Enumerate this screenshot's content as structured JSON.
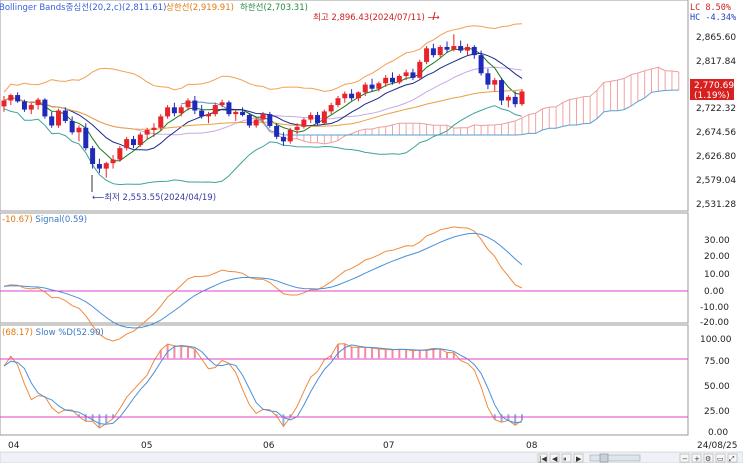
{
  "header": {
    "bb_label": "Bollinger Bands중심선(20,2,c)(2,811.61)",
    "upper_label": "상한선(2,919.91)",
    "lower_label": "하한선(2,703.31)"
  },
  "corner_stats": [
    {
      "key": "LC",
      "value": "8.50%"
    },
    {
      "key": "HC",
      "value": "-4.34%"
    }
  ],
  "annotations": {
    "high": "최고 2,896.43(2024/07/11)",
    "low": "최저 2,553.55(2024/04/19)"
  },
  "price_panel": {
    "yticks": [
      "2,865.60",
      "2,817.84",
      "2,722.32",
      "2,674.56",
      "2,626.80",
      "2,579.04",
      "2,531.28"
    ],
    "ylim": [
      2511,
      2945
    ],
    "current_price": "2,770.69",
    "current_change": "(1.19%)"
  },
  "macd_panel": {
    "macd_label": "-10.67)",
    "signal_label": "Signal(0.59)",
    "yticks": [
      "30.00",
      "20.00",
      "10.00",
      "0.00",
      "-10.00",
      "-20.00"
    ]
  },
  "stoch_panel": {
    "k_label": "(68.17)",
    "d_label": "Slow %D(52.90)",
    "yticks": [
      "100.00",
      "75.00",
      "50.00",
      "25.00",
      "0.00"
    ]
  },
  "x_axis": {
    "ticks": [
      "04",
      "05",
      "06",
      "07",
      "08"
    ],
    "date": "24/08/25"
  },
  "colors": {
    "up": "#e8232a",
    "down": "#1f2ab8",
    "ichimoku_fill": "#f2a1a1",
    "bb_band": "#f0a050",
    "bb_mid": "#c8a8e8",
    "macd": "#f08a3c",
    "signal": "#4a90d9",
    "guide": "#e040c8"
  },
  "chart_data": {
    "type": "candlestick",
    "title": "",
    "indicators": [
      "Bollinger Bands(20,2,c)",
      "Ichimoku cloud",
      "Moving averages",
      "MACD",
      "Signal",
      "Slow %K",
      "Slow %D"
    ],
    "price_ylim": [
      2511,
      2945
    ],
    "macd_ylim": [
      -22,
      38
    ],
    "stoch_ylim": [
      0,
      110
    ],
    "stoch_guides": [
      80,
      20
    ],
    "x_date_range": [
      "2024-03-25",
      "2024-08-23"
    ],
    "candles_ohlc": [
      [
        2737,
        2760,
        2725,
        2750
      ],
      [
        2750,
        2765,
        2740,
        2762
      ],
      [
        2762,
        2768,
        2745,
        2748
      ],
      [
        2748,
        2752,
        2725,
        2730
      ],
      [
        2730,
        2745,
        2720,
        2740
      ],
      [
        2740,
        2756,
        2730,
        2752
      ],
      [
        2752,
        2755,
        2710,
        2715
      ],
      [
        2715,
        2725,
        2690,
        2695
      ],
      [
        2695,
        2732,
        2690,
        2728
      ],
      [
        2728,
        2735,
        2700,
        2705
      ],
      [
        2705,
        2715,
        2675,
        2680
      ],
      [
        2680,
        2695,
        2660,
        2690
      ],
      [
        2690,
        2700,
        2640,
        2645
      ],
      [
        2645,
        2650,
        2600,
        2610
      ],
      [
        2610,
        2622,
        2590,
        2600
      ],
      [
        2600,
        2615,
        2580,
        2612
      ],
      [
        2612,
        2630,
        2600,
        2620
      ],
      [
        2620,
        2650,
        2615,
        2645
      ],
      [
        2645,
        2670,
        2640,
        2665
      ],
      [
        2665,
        2672,
        2645,
        2652
      ],
      [
        2652,
        2680,
        2648,
        2675
      ],
      [
        2675,
        2690,
        2665,
        2685
      ],
      [
        2685,
        2700,
        2670,
        2690
      ],
      [
        2690,
        2720,
        2685,
        2715
      ],
      [
        2715,
        2740,
        2710,
        2735
      ],
      [
        2735,
        2745,
        2715,
        2722
      ],
      [
        2722,
        2740,
        2715,
        2735
      ],
      [
        2735,
        2755,
        2728,
        2750
      ],
      [
        2750,
        2760,
        2720,
        2728
      ],
      [
        2728,
        2740,
        2710,
        2715
      ],
      [
        2715,
        2725,
        2700,
        2720
      ],
      [
        2720,
        2745,
        2715,
        2740
      ],
      [
        2740,
        2752,
        2735,
        2746
      ],
      [
        2746,
        2750,
        2715,
        2720
      ],
      [
        2720,
        2730,
        2705,
        2725
      ],
      [
        2725,
        2735,
        2715,
        2718
      ],
      [
        2718,
        2722,
        2690,
        2695
      ],
      [
        2695,
        2712,
        2690,
        2708
      ],
      [
        2708,
        2725,
        2700,
        2720
      ],
      [
        2720,
        2725,
        2690,
        2694
      ],
      [
        2694,
        2700,
        2665,
        2670
      ],
      [
        2670,
        2680,
        2650,
        2660
      ],
      [
        2660,
        2690,
        2655,
        2685
      ],
      [
        2685,
        2700,
        2676,
        2692
      ],
      [
        2692,
        2712,
        2688,
        2708
      ],
      [
        2708,
        2724,
        2700,
        2718
      ],
      [
        2718,
        2725,
        2696,
        2700
      ],
      [
        2700,
        2730,
        2698,
        2726
      ],
      [
        2726,
        2745,
        2720,
        2740
      ],
      [
        2740,
        2760,
        2735,
        2755
      ],
      [
        2755,
        2770,
        2745,
        2765
      ],
      [
        2765,
        2775,
        2750,
        2755
      ],
      [
        2755,
        2770,
        2748,
        2768
      ],
      [
        2768,
        2790,
        2760,
        2785
      ],
      [
        2785,
        2798,
        2770,
        2776
      ],
      [
        2776,
        2792,
        2770,
        2788
      ],
      [
        2788,
        2806,
        2780,
        2800
      ],
      [
        2800,
        2812,
        2785,
        2790
      ],
      [
        2790,
        2808,
        2786,
        2804
      ],
      [
        2804,
        2818,
        2795,
        2812
      ],
      [
        2812,
        2820,
        2795,
        2800
      ],
      [
        2800,
        2840,
        2798,
        2835
      ],
      [
        2835,
        2870,
        2830,
        2865
      ],
      [
        2865,
        2875,
        2845,
        2850
      ],
      [
        2850,
        2872,
        2845,
        2868
      ],
      [
        2868,
        2880,
        2855,
        2862
      ],
      [
        2862,
        2896,
        2858,
        2870
      ],
      [
        2870,
        2882,
        2855,
        2860
      ],
      [
        2860,
        2875,
        2850,
        2868
      ],
      [
        2868,
        2872,
        2842,
        2850
      ],
      [
        2850,
        2860,
        2805,
        2810
      ],
      [
        2810,
        2820,
        2775,
        2785
      ],
      [
        2785,
        2800,
        2770,
        2795
      ],
      [
        2795,
        2800,
        2740,
        2750
      ],
      [
        2750,
        2762,
        2735,
        2758
      ],
      [
        2758,
        2770,
        2735,
        2742
      ],
      [
        2742,
        2775,
        2738,
        2770
      ]
    ]
  }
}
